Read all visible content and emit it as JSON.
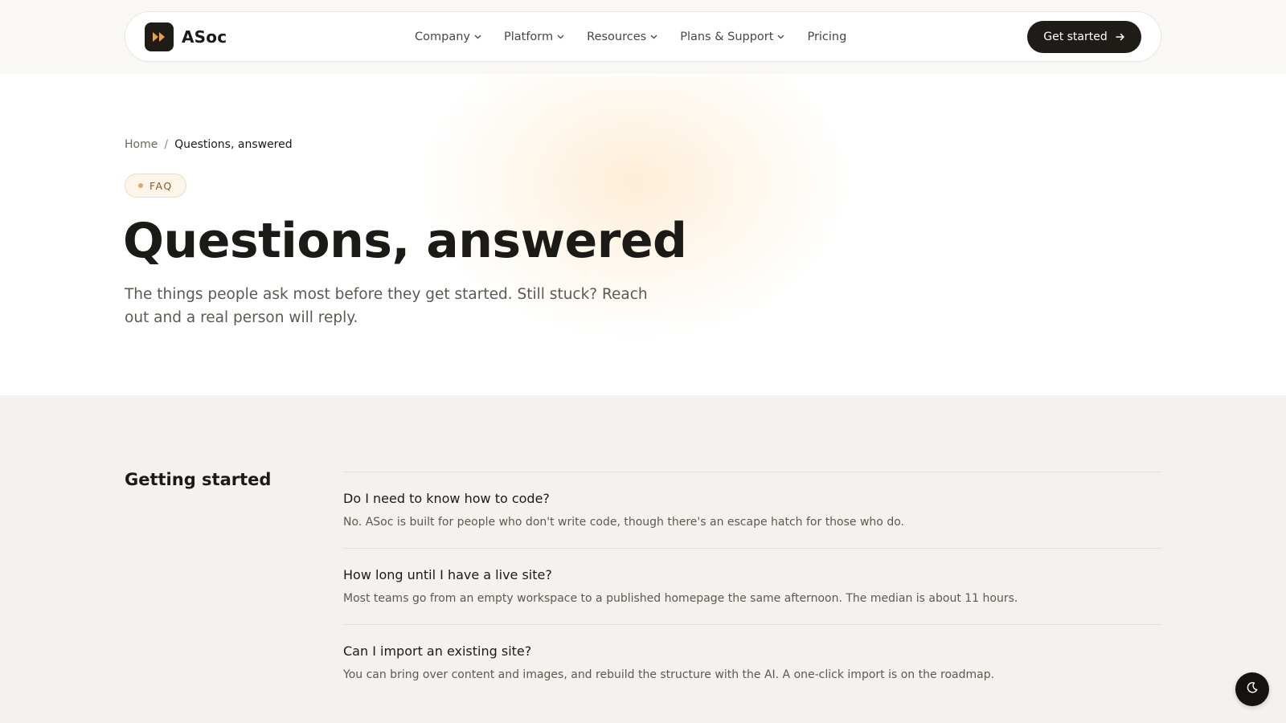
{
  "brand": {
    "name": "ASoc",
    "logo_icon": "fast-forward-icon",
    "accent": "#e8a04f",
    "dark": "#1f1b17"
  },
  "nav": {
    "items": [
      {
        "label": "Company",
        "has_dropdown": true
      },
      {
        "label": "Platform",
        "has_dropdown": true
      },
      {
        "label": "Resources",
        "has_dropdown": true
      },
      {
        "label": "Plans & Support",
        "has_dropdown": true
      },
      {
        "label": "Pricing",
        "has_dropdown": false
      }
    ],
    "cta_label": "Get started",
    "cta_icon": "arrow-right-icon"
  },
  "breadcrumb": {
    "home": "Home",
    "separator": "/",
    "current": "Questions, answered"
  },
  "hero": {
    "badge": "FAQ",
    "title": "Questions, answered",
    "subtitle": "The things people ask most before they get started. Still stuck? Reach out and a real person will reply."
  },
  "faq": {
    "section_title": "Getting started",
    "items": [
      {
        "question": "Do I need to know how to code?",
        "answer": "No. ASoc is built for people who don't write code, though there's an escape hatch for those who do."
      },
      {
        "question": "How long until I have a live site?",
        "answer": "Most teams go from an empty workspace to a published homepage the same afternoon. The median is about 11 hours."
      },
      {
        "question": "Can I import an existing site?",
        "answer": "You can bring over content and images, and rebuild the structure with the AI. A one-click import is on the roadmap."
      }
    ]
  },
  "theme_toggle": {
    "icon": "moon-icon"
  }
}
